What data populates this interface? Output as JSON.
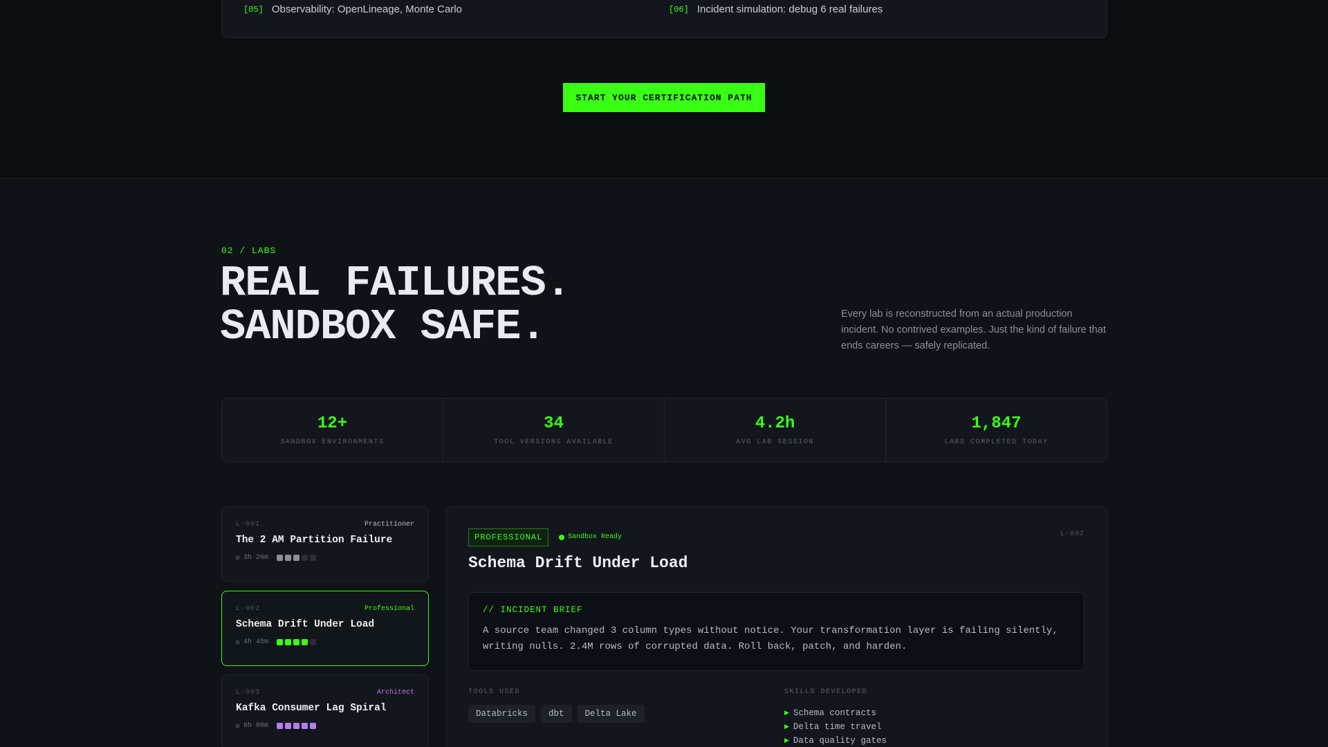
{
  "curriculum": {
    "modules": [
      {
        "num": "[05]",
        "text": "Observability: OpenLineage, Monte Carlo"
      },
      {
        "num": "[06]",
        "text": "Incident simulation: debug 6 real failures"
      }
    ],
    "cta_label": "START YOUR CERTIFICATION PATH"
  },
  "labs_section": {
    "label": "02 / LABS",
    "headline_line1": "REAL FAILURES.",
    "headline_line2": "SANDBOX SAFE.",
    "intro": "Every lab is reconstructed from an actual production incident. No contrived examples. Just the kind of failure that ends careers — safely replicated."
  },
  "stats": [
    {
      "value": "12+",
      "label": "SANDBOX ENVIRONMENTS"
    },
    {
      "value": "34",
      "label": "TOOL VERSIONS AVAILABLE"
    },
    {
      "value": "4.2h",
      "label": "AVG LAB SESSION"
    },
    {
      "value": "1,847",
      "label": "LABS COMPLETED TODAY"
    }
  ],
  "labs": [
    {
      "id": "L-001",
      "level": "Practitioner",
      "level_color": "#b7bcc6",
      "title": "The 2 AM Partition Failure",
      "time": "3h 20m",
      "difficulty": 3,
      "dot_color": "#8b9099"
    },
    {
      "id": "L-002",
      "level": "Professional",
      "level_color": "#39ff14",
      "title": "Schema Drift Under Load",
      "time": "4h 45m",
      "difficulty": 4,
      "dot_color": "#39ff14"
    },
    {
      "id": "L-003",
      "level": "Architect",
      "level_color": "#b77cf0",
      "title": "Kafka Consumer Lag Spiral",
      "time": "6h 00m",
      "difficulty": 5,
      "dot_color": "#b77cf0"
    }
  ],
  "detail": {
    "badge": "PROFESSIONAL",
    "status": "Sandbox Ready",
    "id": "L-002",
    "title": "Schema Drift Under Load",
    "brief_label": "// INCIDENT BRIEF",
    "brief_line1": "A source team changed 3 column types without notice. Your transformation layer is failing silently,",
    "brief_line2": "writing nulls. 2.4M rows of corrupted data. Roll back, patch, and harden.",
    "tools_label": "TOOLS USED",
    "tools": [
      "Databricks",
      "dbt",
      "Delta Lake"
    ],
    "skills_label": "SKILLS DEVELOPED",
    "skills": [
      "Schema contracts",
      "Delta time travel",
      "Data quality gates"
    ]
  },
  "colors": {
    "accent": "#39ff14",
    "background": "#0b0d11",
    "panel": "#13171d"
  }
}
